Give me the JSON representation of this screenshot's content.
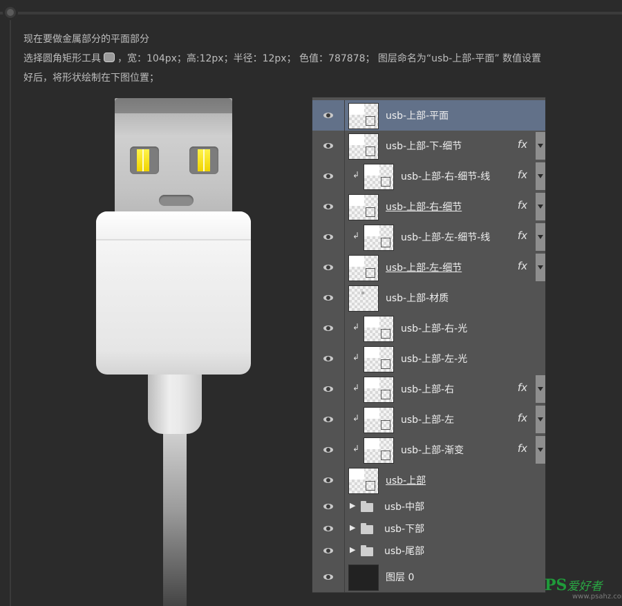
{
  "intro": {
    "line1": "现在要做金属部分的平面部分",
    "line2a": "选择圆角矩形工具",
    "line2b": "，宽：104px；高:12px；半径：12px； 色值：787878； 图层命名为“usb-上部-平面” 数值设置",
    "line3": "好后，将形状绘制在下图位置；"
  },
  "layers": [
    {
      "name": "usb-上部-平面",
      "selected": true,
      "fx": false,
      "clipped": false,
      "underline": false,
      "thumb": "shape"
    },
    {
      "name": "usb-上部-下-细节",
      "fx": true,
      "clipped": false,
      "underline": false,
      "thumb": "shape"
    },
    {
      "name": "usb-上部-右-细节-线",
      "fx": true,
      "clipped": true,
      "underline": false,
      "thumb": "shape"
    },
    {
      "name": "usb-上部-右-细节",
      "fx": true,
      "clipped": false,
      "underline": true,
      "thumb": "shape"
    },
    {
      "name": "usb-上部-左-细节-线",
      "fx": true,
      "clipped": true,
      "underline": false,
      "thumb": "shape"
    },
    {
      "name": "usb-上部-左-细节",
      "fx": true,
      "clipped": false,
      "underline": true,
      "thumb": "shape"
    },
    {
      "name": "usb-上部-材质",
      "fx": false,
      "clipped": false,
      "underline": false,
      "thumb": "pixel"
    },
    {
      "name": "usb-上部-右-光",
      "fx": false,
      "clipped": true,
      "underline": false,
      "thumb": "shape"
    },
    {
      "name": "usb-上部-左-光",
      "fx": false,
      "clipped": true,
      "underline": false,
      "thumb": "shape"
    },
    {
      "name": "usb-上部-右",
      "fx": true,
      "clipped": true,
      "underline": false,
      "thumb": "shape"
    },
    {
      "name": "usb-上部-左",
      "fx": true,
      "clipped": true,
      "underline": false,
      "thumb": "shape"
    },
    {
      "name": "usb-上部-渐变",
      "fx": true,
      "clipped": true,
      "underline": false,
      "thumb": "shape"
    },
    {
      "name": "usb-上部",
      "fx": false,
      "clipped": false,
      "underline": true,
      "thumb": "shape"
    }
  ],
  "groups": [
    {
      "name": "usb-中部"
    },
    {
      "name": "usb-下部"
    },
    {
      "name": "usb-尾部"
    }
  ],
  "background_layer": {
    "name": "图层 0"
  },
  "fx_label": "fx",
  "watermark": {
    "ps": "PS",
    "cn": "爱好者",
    "url": "www.psahz.com"
  },
  "colors": {
    "selected_row": "#627189",
    "panel": "#535353",
    "contact_yellow": "#fff34a",
    "flat_shape": "#787878"
  }
}
